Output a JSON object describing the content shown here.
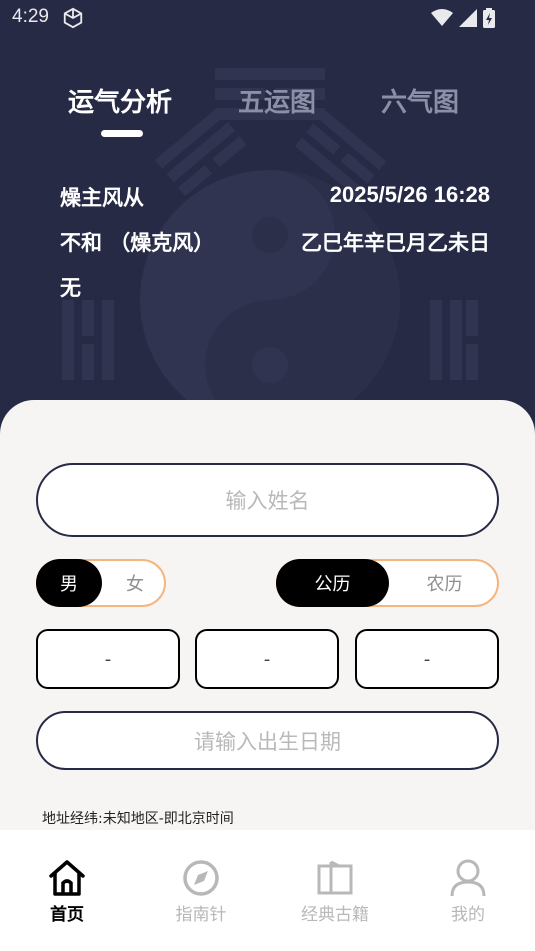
{
  "status": {
    "time": "4:29"
  },
  "tabs": [
    {
      "label": "运气分析",
      "active": true
    },
    {
      "label": "五运图",
      "active": false
    },
    {
      "label": "六气图",
      "active": false
    }
  ],
  "info": {
    "left_line1": "燥主风从",
    "left_line2": "不和 （燥克风）",
    "left_line3": "无",
    "datetime": "2025/5/26  16:28",
    "ganzhi": "乙巳年辛巳月乙未日"
  },
  "form": {
    "name_placeholder": "输入姓名",
    "gender": {
      "male": "男",
      "female": "女",
      "selected": "男"
    },
    "calendar": {
      "solar": "公历",
      "lunar": "农历",
      "selected": "公历"
    },
    "selects": [
      "-",
      "-",
      "-"
    ],
    "birth_placeholder": "请输入出生日期",
    "address": "地址经纬:未知地区-即北京时间"
  },
  "nav": [
    {
      "label": "首页",
      "icon": "home-icon",
      "active": true
    },
    {
      "label": "指南针",
      "icon": "compass-icon",
      "active": false
    },
    {
      "label": "经典古籍",
      "icon": "book-icon",
      "active": false
    },
    {
      "label": "我的",
      "icon": "user-icon",
      "active": false
    }
  ],
  "colors": {
    "header_bg": "#262a45",
    "accent_border": "#f5b57e",
    "selected_bg": "#000000",
    "inactive_tab": "#8c8fa6",
    "placeholder": "#b9b9b9"
  }
}
